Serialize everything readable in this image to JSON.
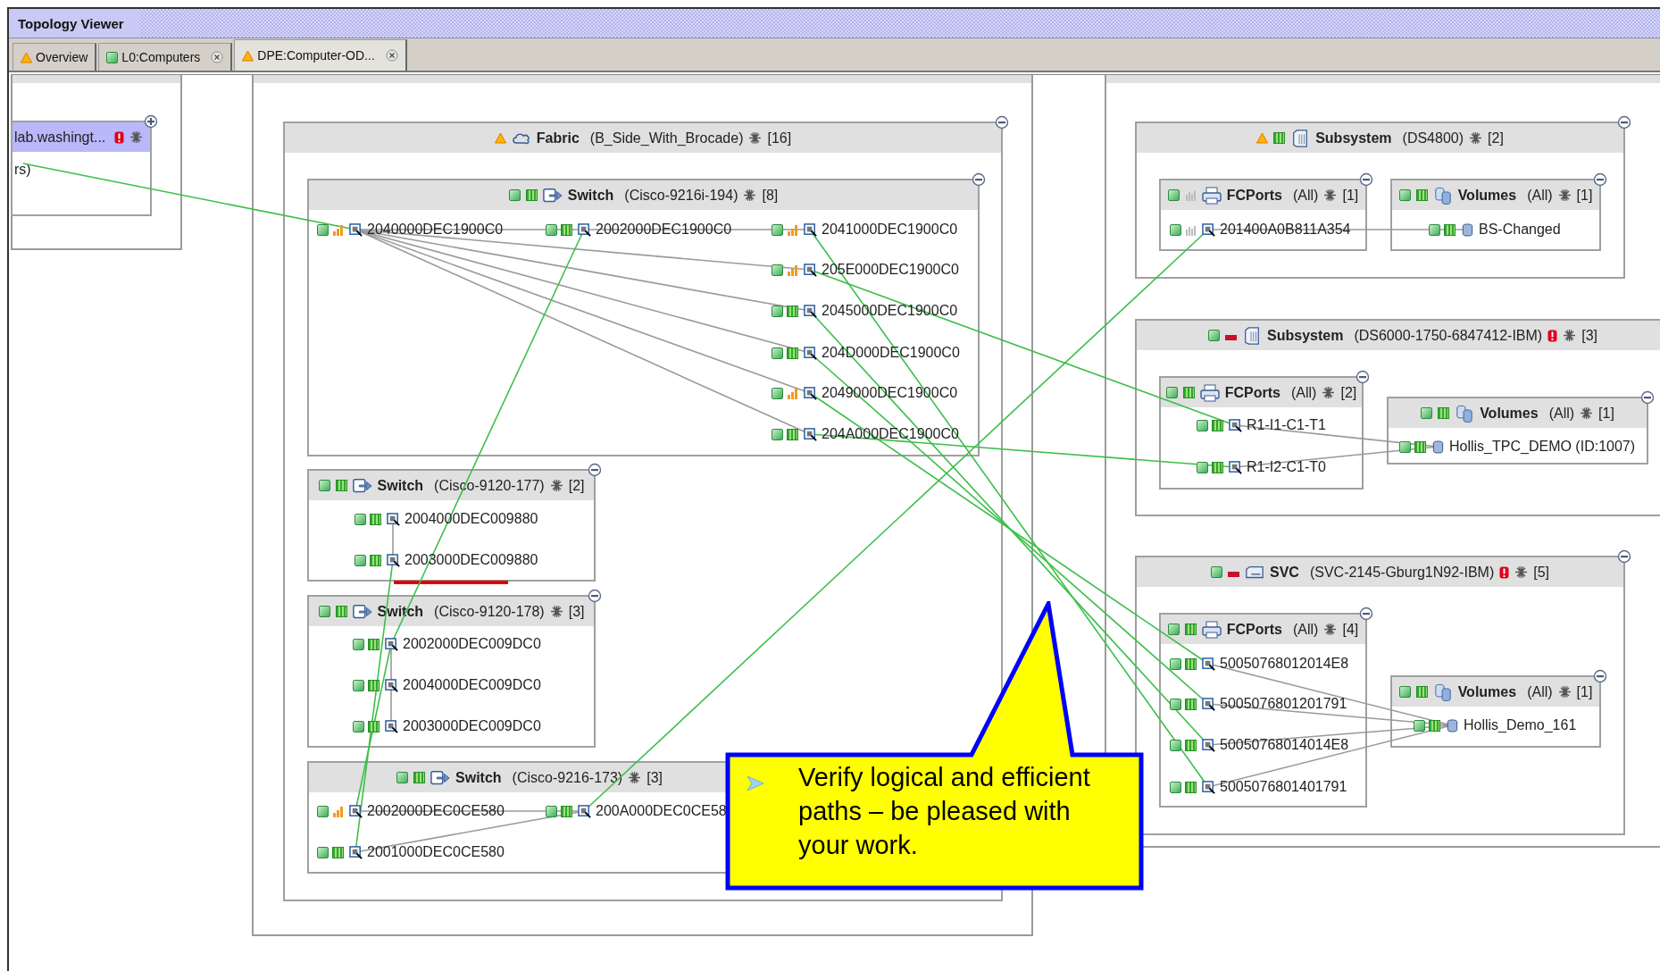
{
  "window": {
    "title": "Topology Viewer"
  },
  "tabs": [
    {
      "label": "Overview",
      "warning": true,
      "closable": false,
      "selected": false
    },
    {
      "label": "L0:Computers",
      "warning": false,
      "closable": true,
      "selected": false
    },
    {
      "label": "DPE:Computer-OD...",
      "warning": true,
      "closable": true,
      "selected": true
    }
  ],
  "host": {
    "title": "lab.washingt...",
    "error": true,
    "lines": [
      "rs)"
    ]
  },
  "fabric": {
    "kind": "fabric",
    "title": "Fabric",
    "detail": "(B_Side_With_Brocade)",
    "count": "[16]",
    "badges": [
      {
        "kind": "warning"
      }
    ],
    "switches": [
      {
        "kind": "switch",
        "title": "Switch",
        "detail": "(Cisco-9216i-194)",
        "count": "[8]",
        "badges": [
          {
            "kind": "ok"
          },
          {
            "kind": "perf_ok"
          }
        ],
        "ports": [
          {
            "label": "2040000DEC1900C0",
            "badges": [
              {
                "kind": "ok"
              },
              {
                "kind": "perf_warning"
              }
            ]
          },
          {
            "label": "2002000DEC1900C0",
            "badges": [
              {
                "kind": "ok"
              },
              {
                "kind": "perf_ok"
              }
            ]
          },
          {
            "label": "2041000DEC1900C0",
            "badges": [
              {
                "kind": "ok"
              },
              {
                "kind": "perf_warning"
              }
            ]
          },
          {
            "label": "205E000DEC1900C0",
            "badges": [
              {
                "kind": "ok"
              },
              {
                "kind": "perf_warning"
              }
            ]
          },
          {
            "label": "2045000DEC1900C0",
            "badges": [
              {
                "kind": "ok"
              },
              {
                "kind": "perf_ok"
              }
            ]
          },
          {
            "label": "204D000DEC1900C0",
            "badges": [
              {
                "kind": "ok"
              },
              {
                "kind": "perf_ok"
              }
            ]
          },
          {
            "label": "2049000DEC1900C0",
            "badges": [
              {
                "kind": "ok"
              },
              {
                "kind": "perf_warning"
              }
            ]
          },
          {
            "label": "204A000DEC1900C0",
            "badges": [
              {
                "kind": "ok"
              },
              {
                "kind": "perf_ok"
              }
            ]
          }
        ]
      },
      {
        "kind": "switch",
        "title": "Switch",
        "detail": "(Cisco-9120-177)",
        "count": "[2]",
        "badges": [
          {
            "kind": "ok"
          },
          {
            "kind": "perf_ok"
          }
        ],
        "ports": [
          {
            "label": "2004000DEC009880",
            "badges": [
              {
                "kind": "ok"
              },
              {
                "kind": "perf_ok"
              }
            ]
          },
          {
            "label": "2003000DEC009880",
            "badges": [
              {
                "kind": "ok"
              },
              {
                "kind": "perf_ok"
              }
            ]
          }
        ]
      },
      {
        "kind": "switch",
        "title": "Switch",
        "detail": "(Cisco-9120-178)",
        "count": "[3]",
        "badges": [
          {
            "kind": "ok"
          },
          {
            "kind": "perf_ok"
          }
        ],
        "ports": [
          {
            "label": "2002000DEC009DC0",
            "badges": [
              {
                "kind": "ok"
              },
              {
                "kind": "perf_ok"
              }
            ]
          },
          {
            "label": "2004000DEC009DC0",
            "badges": [
              {
                "kind": "ok"
              },
              {
                "kind": "perf_ok"
              }
            ]
          },
          {
            "label": "2003000DEC009DC0",
            "badges": [
              {
                "kind": "ok"
              },
              {
                "kind": "perf_ok"
              }
            ]
          }
        ]
      },
      {
        "kind": "switch",
        "title": "Switch",
        "detail": "(Cisco-9216-173)",
        "count": "[3]",
        "badges": [
          {
            "kind": "ok"
          },
          {
            "kind": "perf_ok"
          }
        ],
        "ports": [
          {
            "label": "2002000DEC0CE580",
            "badges": [
              {
                "kind": "ok"
              },
              {
                "kind": "perf_warning"
              }
            ]
          },
          {
            "label": "200A000DEC0CE58",
            "badges": [
              {
                "kind": "ok"
              },
              {
                "kind": "perf_ok"
              }
            ]
          },
          {
            "label": "2001000DEC0CE580",
            "badges": [
              {
                "kind": "ok"
              },
              {
                "kind": "perf_ok"
              }
            ]
          }
        ]
      }
    ]
  },
  "storage": [
    {
      "kind": "subsystem",
      "title": "Subsystem",
      "detail": "(DS4800)",
      "count": "[2]",
      "badges": [
        {
          "kind": "warning"
        },
        {
          "kind": "perf_ok"
        }
      ],
      "error": false,
      "children": [
        {
          "kind": "fcports",
          "title": "FCPorts",
          "detail": "(All)",
          "count": "[1]",
          "badges": [
            {
              "kind": "ok"
            },
            {
              "kind": "perf_unknown"
            }
          ],
          "items": [
            {
              "label": "201400A0B811A354",
              "badges": [
                {
                  "kind": "ok"
                },
                {
                  "kind": "perf_unknown"
                }
              ]
            }
          ]
        },
        {
          "kind": "volumes",
          "title": "Volumes",
          "detail": "(All)",
          "count": "[1]",
          "badges": [
            {
              "kind": "ok"
            },
            {
              "kind": "perf_ok"
            }
          ],
          "items": [
            {
              "label": "BS-Changed",
              "badges": [
                {
                  "kind": "ok"
                },
                {
                  "kind": "perf_ok"
                }
              ]
            }
          ]
        }
      ]
    },
    {
      "kind": "subsystem",
      "title": "Subsystem",
      "detail": "(DS6000-1750-6847412-IBM)",
      "count": "[3]",
      "badges": [
        {
          "kind": "ok"
        },
        {
          "kind": "perf_critical"
        }
      ],
      "error": true,
      "children": [
        {
          "kind": "fcports",
          "title": "FCPorts",
          "detail": "(All)",
          "count": "[2]",
          "badges": [
            {
              "kind": "ok"
            },
            {
              "kind": "perf_ok"
            }
          ],
          "items": [
            {
              "label": "R1-I1-C1-T1",
              "badges": [
                {
                  "kind": "ok"
                },
                {
                  "kind": "perf_ok"
                }
              ]
            },
            {
              "label": "R1-I2-C1-T0",
              "badges": [
                {
                  "kind": "ok"
                },
                {
                  "kind": "perf_ok"
                }
              ]
            }
          ]
        },
        {
          "kind": "volumes",
          "title": "Volumes",
          "detail": "(All)",
          "count": "[1]",
          "badges": [
            {
              "kind": "ok"
            },
            {
              "kind": "perf_ok"
            }
          ],
          "items": [
            {
              "label": "Hollis_TPC_DEMO (ID:1007)",
              "badges": [
                {
                  "kind": "ok"
                },
                {
                  "kind": "perf_ok"
                }
              ]
            }
          ]
        }
      ]
    },
    {
      "kind": "svc",
      "title": "SVC",
      "detail": "(SVC-2145-Gburg1N92-IBM)",
      "count": "[5]",
      "badges": [
        {
          "kind": "ok"
        },
        {
          "kind": "perf_critical"
        }
      ],
      "error": true,
      "children": [
        {
          "kind": "fcports",
          "title": "FCPorts",
          "detail": "(All)",
          "count": "[4]",
          "badges": [
            {
              "kind": "ok"
            },
            {
              "kind": "perf_ok"
            }
          ],
          "items": [
            {
              "label": "50050768012014E8",
              "badges": [
                {
                  "kind": "ok"
                },
                {
                  "kind": "perf_ok"
                }
              ]
            },
            {
              "label": "5005076801201791",
              "badges": [
                {
                  "kind": "ok"
                },
                {
                  "kind": "perf_ok"
                }
              ]
            },
            {
              "label": "50050768014014E8",
              "badges": [
                {
                  "kind": "ok"
                },
                {
                  "kind": "perf_ok"
                }
              ]
            },
            {
              "label": "5005076801401791",
              "badges": [
                {
                  "kind": "ok"
                },
                {
                  "kind": "perf_ok"
                }
              ]
            }
          ]
        },
        {
          "kind": "volumes",
          "title": "Volumes",
          "detail": "(All)",
          "count": "[1]",
          "badges": [
            {
              "kind": "ok"
            },
            {
              "kind": "perf_ok"
            }
          ],
          "items": [
            {
              "label": "Hollis_Demo_161",
              "badges": [
                {
                  "kind": "ok"
                },
                {
                  "kind": "perf_ok"
                }
              ]
            }
          ]
        }
      ]
    }
  ],
  "callout": {
    "text": "Verify logical and efficient paths – be pleased with your work."
  }
}
